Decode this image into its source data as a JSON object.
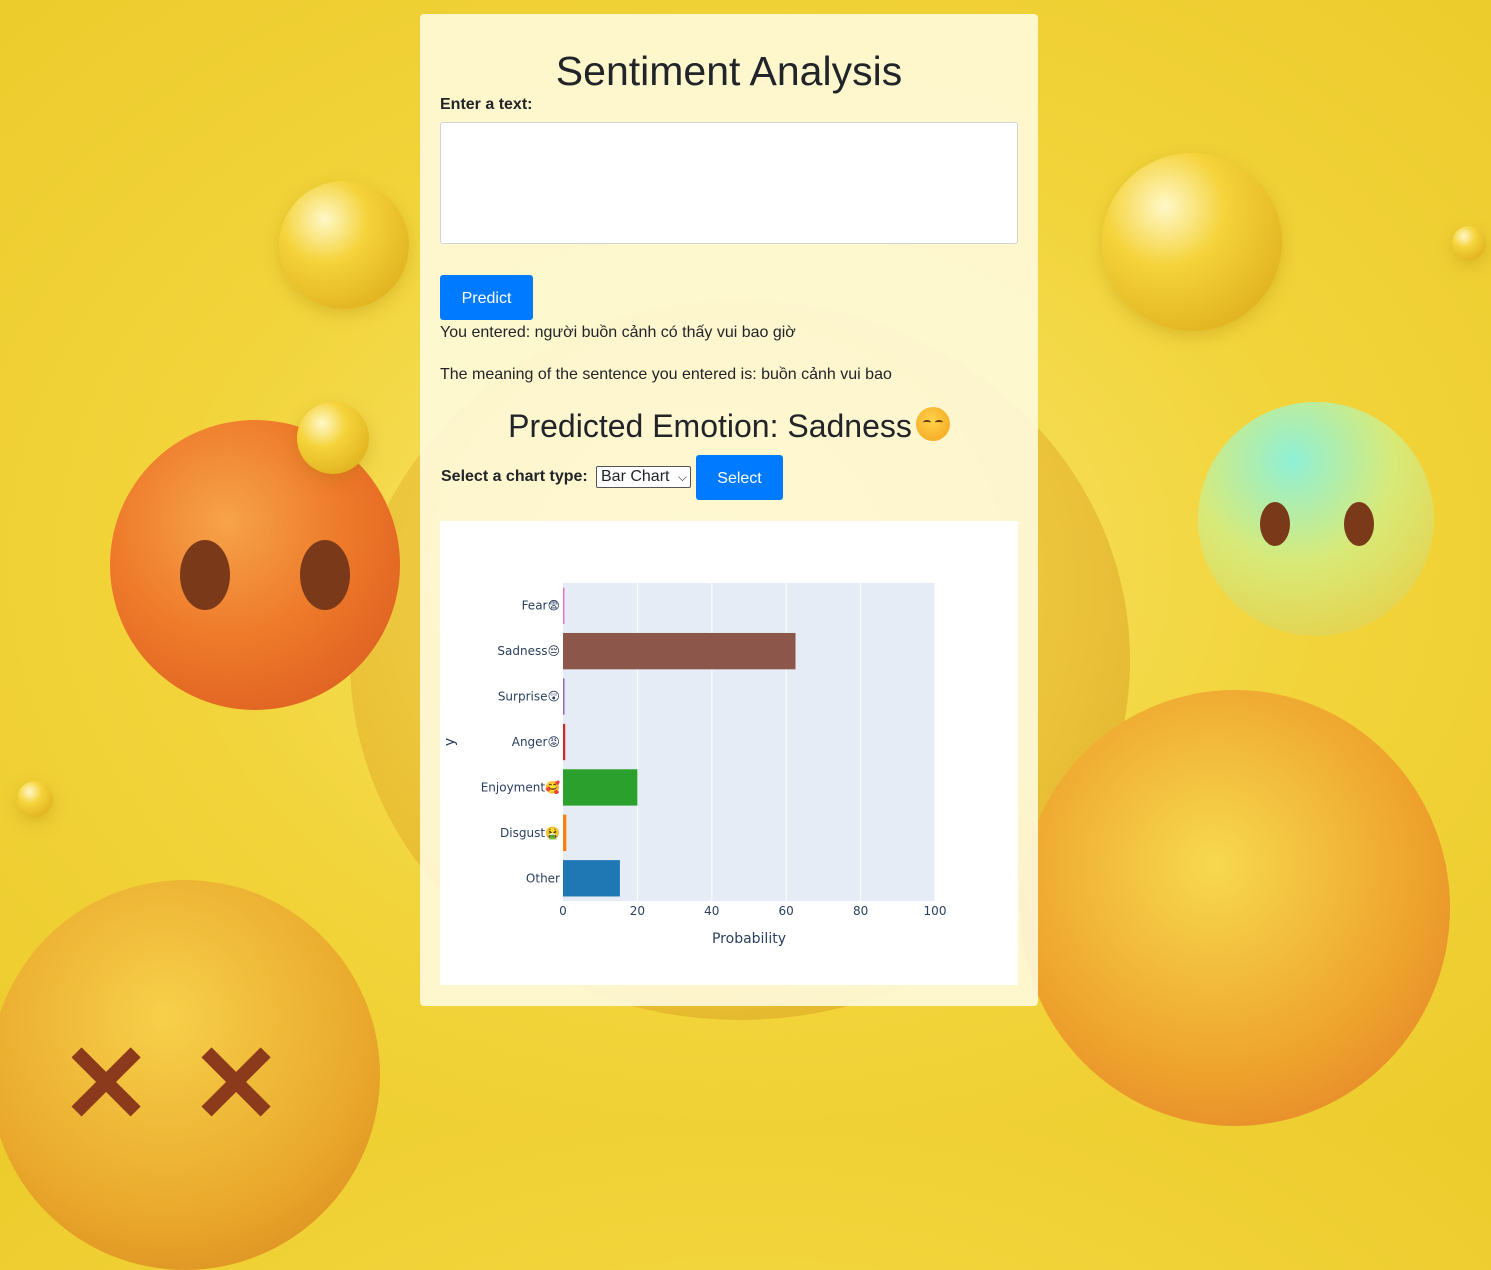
{
  "page": {
    "title": "Sentiment Analysis",
    "input_label": "Enter a text:",
    "input_value": "",
    "predict_label": "Predict",
    "you_entered": "You entered: người buồn cảnh có thấy vui bao giờ",
    "meaning": "The meaning of the sentence you entered is: buồn cảnh vui bao",
    "predicted_emotion": "Predicted Emotion: Sadness",
    "chart_type_label": "Select a chart type:",
    "chart_type_value": "Bar Chart",
    "select_label": "Select"
  },
  "colors": {
    "primary_button": "#007bff"
  },
  "chart_data": {
    "type": "bar",
    "orientation": "horizontal",
    "categories": [
      "Other",
      "Disgust🤮",
      "Enjoyment🥰",
      "Anger😡",
      "Surprise😲",
      "Sadness😔",
      "Fear😨"
    ],
    "values": [
      15.3,
      0.9,
      20,
      0.6,
      0.3,
      62.5,
      0.3
    ],
    "colors": [
      "#1f77b4",
      "#ff7f0e",
      "#2ca02c",
      "#d62728",
      "#9467bd",
      "#8c564b",
      "#e377c2"
    ],
    "xlabel": "Probability",
    "ylabel": "y",
    "xlim": [
      0,
      100
    ],
    "xticks": [
      0,
      20,
      40,
      60,
      80,
      100
    ],
    "grid": true
  }
}
